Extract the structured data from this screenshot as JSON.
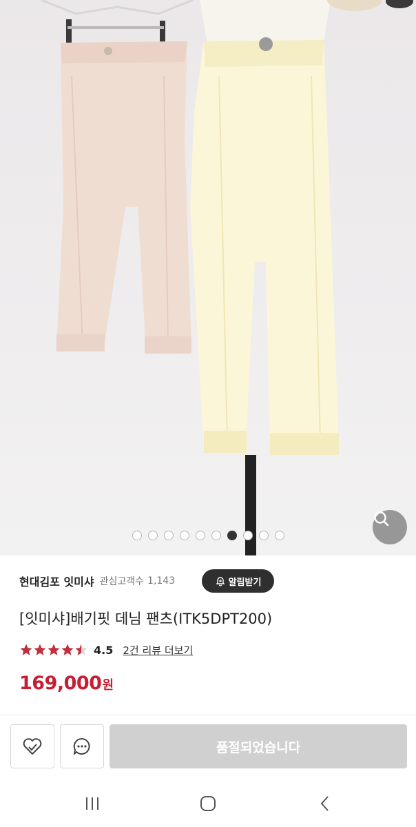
{
  "product": {
    "store_name": "현대김포 잇미샤",
    "fans_label": "관심고객수",
    "fans_count": "1,143",
    "alert_label": "알림받기",
    "title": "[잇미샤]배기핏 데님 팬츠(ITK5DPT200)",
    "rating": "4.5",
    "rating_value": 4.5,
    "review_link": "2건 리뷰 더보기",
    "price": "169,000",
    "currency": "원"
  },
  "gallery": {
    "total_slides": 10,
    "active_slide": 7
  },
  "actions": {
    "soldout_label": "품절되었습니다"
  },
  "colors": {
    "accent_price": "#c81d33",
    "star": "#c0303f",
    "alert_button_bg": "#2f2f2f",
    "soldout_bg": "#d0d0d0"
  },
  "icons": {
    "zoom": "search-icon",
    "bell": "bell-plus-icon",
    "wishlist": "heart-icon",
    "chat": "chat-bubble-icon",
    "nav_recent": "recent-apps-icon",
    "nav_home": "home-icon",
    "nav_back": "back-icon"
  }
}
